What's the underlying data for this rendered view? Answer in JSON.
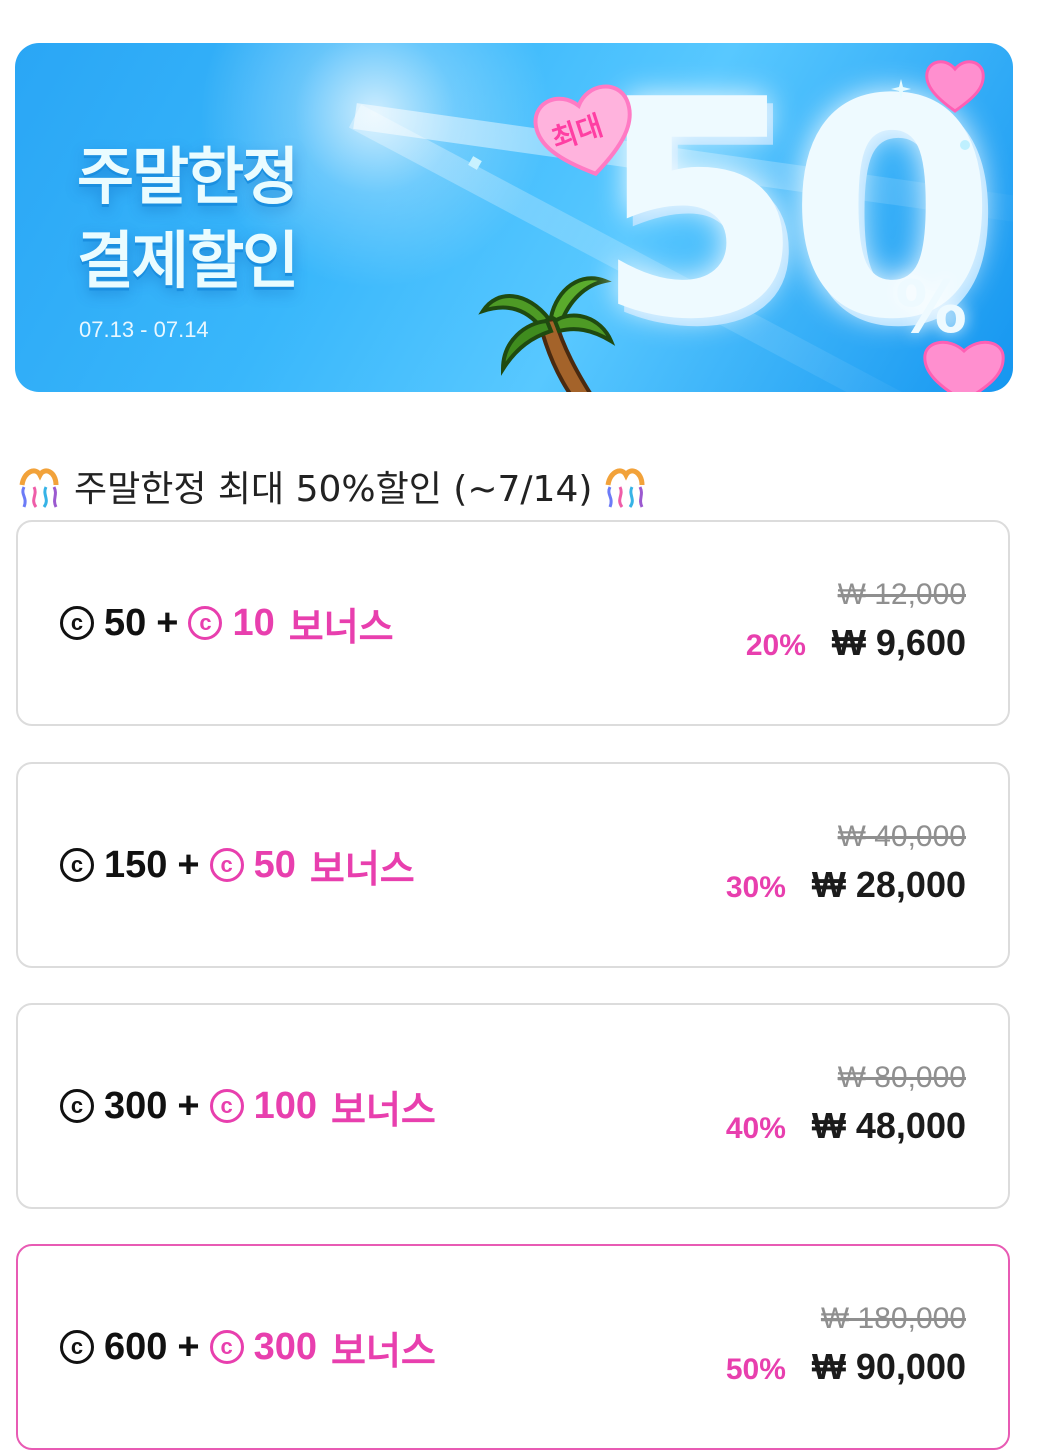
{
  "banner": {
    "title_line1": "주말한정",
    "title_line2": "결제할인",
    "date_range": "07.13 - 07.14",
    "badge_text": "최대",
    "big_number": "50",
    "big_percent": "%",
    "colors": {
      "background": "#2aa6f5",
      "accent": "#ff5fb4"
    }
  },
  "section": {
    "title": "주말한정 최대 50%할인 (~7/14)",
    "icon_left": "party-popper-icon",
    "icon_right": "party-popper-icon"
  },
  "products": [
    {
      "coin_symbol": "c",
      "base": "50",
      "plus": "+",
      "bonus_amount": "10",
      "bonus_label": "보너스",
      "original_price": "₩ 12,000",
      "discount": "20%",
      "price": "₩ 9,600",
      "selected": false
    },
    {
      "coin_symbol": "c",
      "base": "150",
      "plus": "+",
      "bonus_amount": "50",
      "bonus_label": "보너스",
      "original_price": "₩ 40,000",
      "discount": "30%",
      "price": "₩ 28,000",
      "selected": false
    },
    {
      "coin_symbol": "c",
      "base": "300",
      "plus": "+",
      "bonus_amount": "100",
      "bonus_label": "보너스",
      "original_price": "₩ 80,000",
      "discount": "40%",
      "price": "₩ 48,000",
      "selected": false
    },
    {
      "coin_symbol": "c",
      "base": "600",
      "plus": "+",
      "bonus_amount": "300",
      "bonus_label": "보너스",
      "original_price": "₩ 180,000",
      "discount": "50%",
      "price": "₩ 90,000",
      "selected": true
    }
  ],
  "colors": {
    "accent_pink": "#e83fae",
    "card_border": "#dcdcdc",
    "selected_border": "#e85bb4",
    "text_dark": "#111111",
    "strike_gray": "#8f8f8f"
  }
}
